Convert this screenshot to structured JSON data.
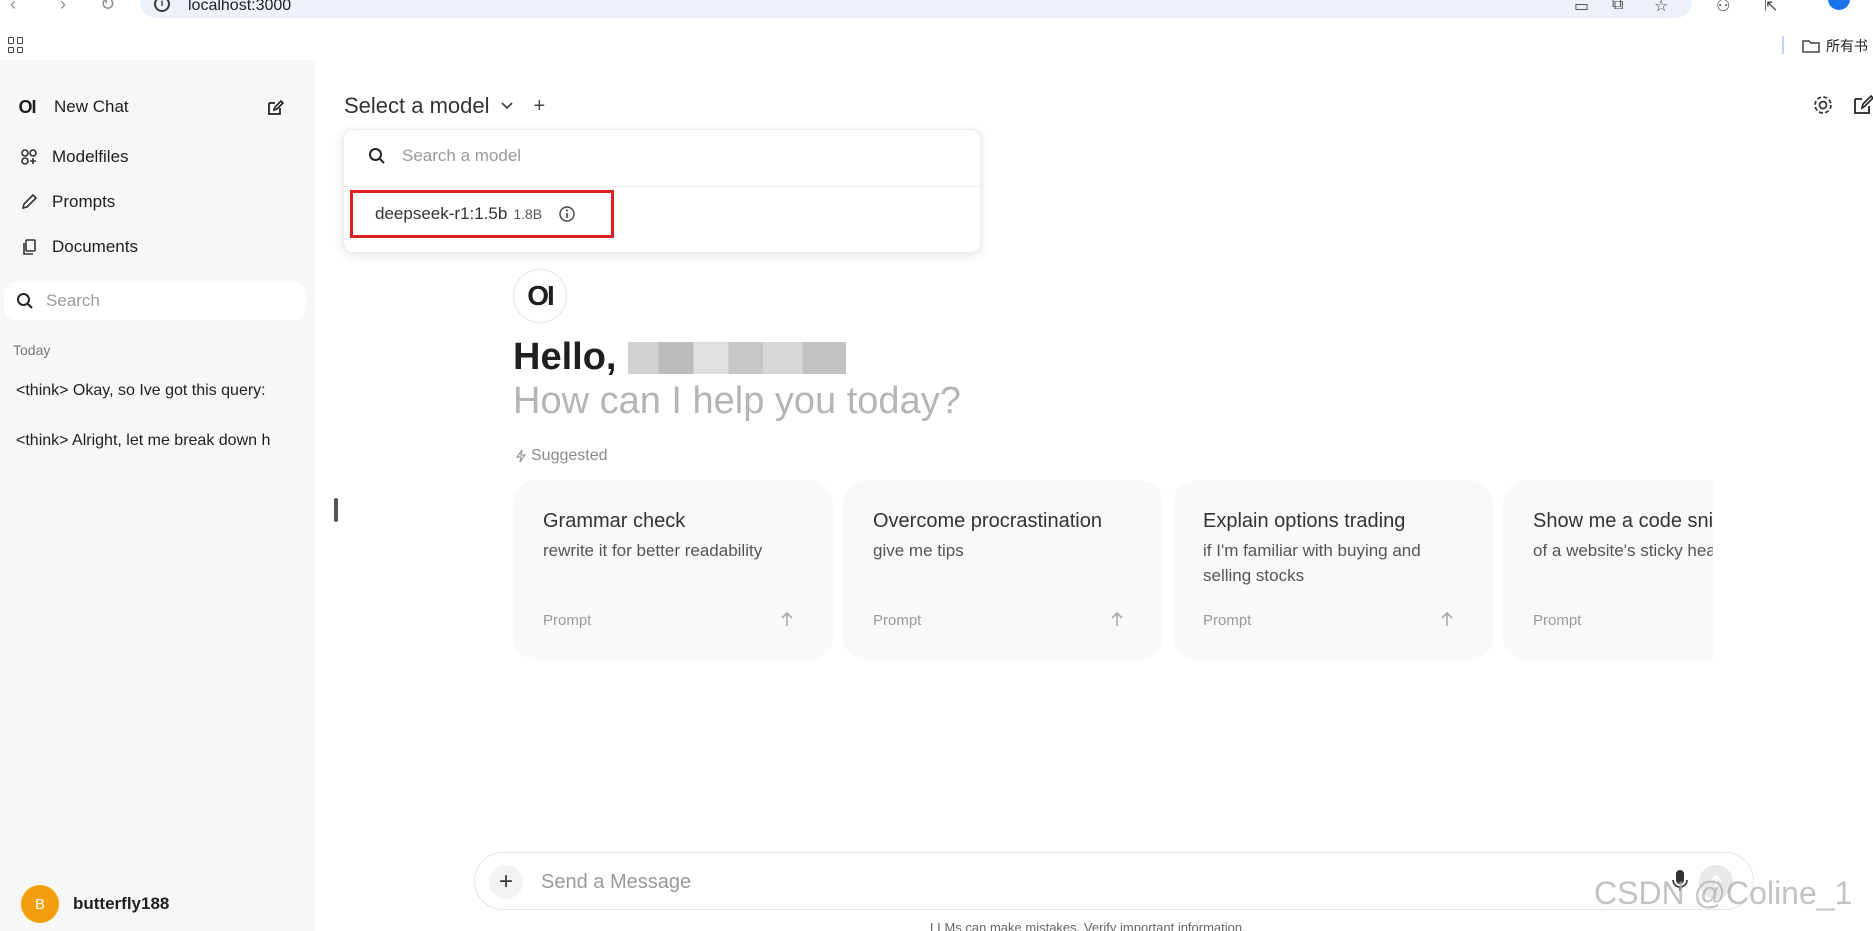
{
  "browser": {
    "url": "localhost:3000",
    "bookmark_folder_label": "所有书"
  },
  "sidebar": {
    "new_chat_label": "New Chat",
    "logo_text": "OI",
    "nav_items": [
      {
        "label": "Modelfiles",
        "icon": "modelfiles-icon"
      },
      {
        "label": "Prompts",
        "icon": "pencil-icon"
      },
      {
        "label": "Documents",
        "icon": "documents-icon"
      }
    ],
    "search_placeholder": "Search",
    "section_label": "Today",
    "chats": [
      "<think> Okay, so Ive got this query:",
      "<think> Alright, let me break down h"
    ],
    "user": {
      "initial": "B",
      "name": "butterfly188",
      "avatar_color": "#f59e0b"
    }
  },
  "header": {
    "model_select_label": "Select a model",
    "add_model_label": "+"
  },
  "model_dropdown": {
    "search_placeholder": "Search a model",
    "items": [
      {
        "name": "deepseek-r1:1.5b",
        "size": "1.8B",
        "highlight_color": "#e02020"
      }
    ]
  },
  "hero": {
    "logo_text": "OI",
    "greeting": "Hello,",
    "subtitle": "How can I help you today?"
  },
  "suggested": {
    "label": "Suggested",
    "cards": [
      {
        "title": "Grammar check",
        "subtitle": "rewrite it for better readability",
        "tag": "Prompt"
      },
      {
        "title": "Overcome procrastination",
        "subtitle": "give me tips",
        "tag": "Prompt"
      },
      {
        "title": "Explain options trading",
        "subtitle": "if I'm familiar with buying and selling stocks",
        "tag": "Prompt"
      },
      {
        "title": "Show me a code snippet",
        "subtitle": "of a website's sticky header",
        "tag": "Prompt"
      }
    ]
  },
  "input": {
    "placeholder": "Send a Message",
    "plus_label": "+"
  },
  "footer": {
    "disclaimer": "LLMs can make mistakes. Verify important information.",
    "watermark": "CSDN @Coline_1"
  }
}
